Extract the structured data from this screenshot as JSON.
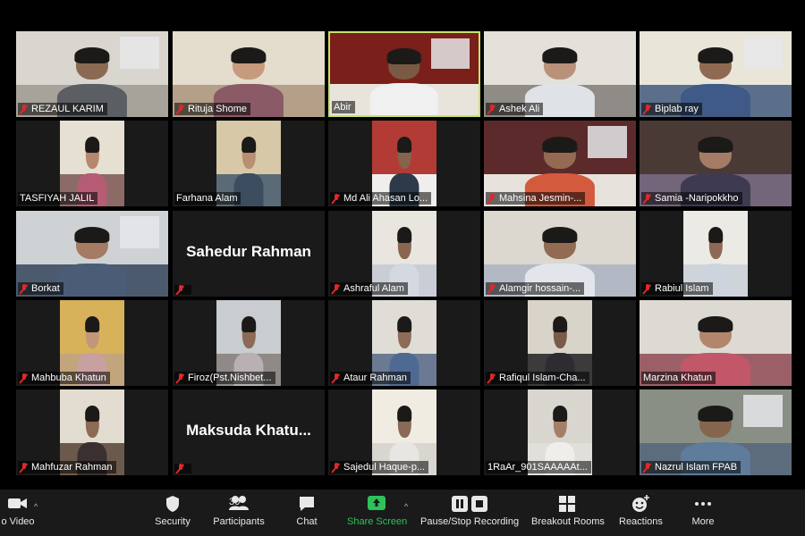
{
  "tiles": [
    {
      "name": "REZAUL KARIM",
      "muted": true,
      "wall": "#d9d6cf",
      "floor": "#a7a39a",
      "skin": "#8a6a52",
      "shirt": "#5b5e62"
    },
    {
      "name": "Rituja Shome",
      "muted": true,
      "wall": "#e4dccc",
      "floor": "#b49f88",
      "skin": "#c69a7c",
      "shirt": "#8a5a67"
    },
    {
      "name": "Abir",
      "muted": false,
      "active": true,
      "wall": "#7a1f1a",
      "floor": "#e8e4dc",
      "skin": "#7a5a45",
      "shirt": "#f0f0f0"
    },
    {
      "name": "Ashek Ali",
      "muted": true,
      "wall": "#e3e1da",
      "floor": "#8f8b86",
      "skin": "#b9917a",
      "shirt": "#dfe2e6"
    },
    {
      "name": "Biplab ray",
      "muted": true,
      "wall": "#e9e5d9",
      "floor": "#5b6f8b",
      "skin": "#8f6a52",
      "shirt": "#3f5a86"
    },
    {
      "name": "TASFIYAH JALIL",
      "muted": false,
      "wall": "#e6e0d2",
      "floor": "#8c6b67",
      "skin": "#b6876c",
      "shirt": "#b65c74"
    },
    {
      "name": "Farhana Alam",
      "muted": false,
      "wall": "#d7c8a8",
      "floor": "#5b6a77",
      "skin": "#b98e72",
      "shirt": "#3b4d5e"
    },
    {
      "name": "Md Ali Ahasan Lo...",
      "muted": true,
      "wall": "#b33b35",
      "floor": "#f0eeec",
      "skin": "#86634d",
      "shirt": "#2c3a4a"
    },
    {
      "name": "Mahsina Jesmin-...",
      "muted": true,
      "wall": "#5c2a2a",
      "floor": "#e7e2dc",
      "skin": "#946a52",
      "shirt": "#d35a3d"
    },
    {
      "name": "Samia -Naripokkho",
      "muted": true,
      "wall": "#4a3a35",
      "floor": "#73657a",
      "skin": "#a47c66",
      "shirt": "#3e3a52"
    },
    {
      "name": "Borkat",
      "muted": true,
      "wall": "#cfd2d5",
      "floor": "#4c5a6e",
      "skin": "#a57b63",
      "shirt": "#4b5c76"
    },
    {
      "name": "",
      "bigname": "Sahedur Rahman",
      "muted": true
    },
    {
      "name": "Ashraful Alam",
      "muted": true,
      "wall": "#e9e6df",
      "floor": "#c9ced6",
      "skin": "#8a6550",
      "shirt": "#d4d8e0"
    },
    {
      "name": "Alamgir hossain-...",
      "muted": true,
      "wall": "#dcd8cf",
      "floor": "#b3b9c4",
      "skin": "#916b54",
      "shirt": "#e2e6ec"
    },
    {
      "name": "Rabiul Islam",
      "muted": true,
      "wall": "#eceae4",
      "floor": "#cfd4da",
      "skin": "#8d6a56",
      "shirt": "#cdd4dd"
    },
    {
      "name": "Mahbuba Khatun",
      "muted": true,
      "wall": "#d7b25a",
      "floor": "#c3a57c",
      "skin": "#c29678",
      "shirt": "#c9a0a0"
    },
    {
      "name": "Firoz(Pst.Nishbet...",
      "muted": true,
      "wall": "#c9ccd0",
      "floor": "#8f8a87",
      "skin": "#8c6a55",
      "shirt": "#b8b0b2"
    },
    {
      "name": "Ataur Rahman",
      "muted": true,
      "wall": "#e0ddd6",
      "floor": "#6b7a92",
      "skin": "#8d6c58",
      "shirt": "#4e6a93"
    },
    {
      "name": "Rafiqul Islam-Cha...",
      "muted": true,
      "wall": "#d9d4c9",
      "floor": "#3d3a3c",
      "skin": "#7a5a48",
      "shirt": "#2e2c30"
    },
    {
      "name": "Marzina Khatun",
      "muted": false,
      "wall": "#dcdad2",
      "floor": "#9b6067",
      "skin": "#b3866b",
      "shirt": "#c2576a"
    },
    {
      "name": "Mahfuzar Rahman",
      "muted": true,
      "wall": "#e2ddd0",
      "floor": "#6b5a4c",
      "skin": "#8c6b55",
      "shirt": "#3a3030"
    },
    {
      "name": "",
      "bigname": "Maksuda  Khatu...",
      "muted": true
    },
    {
      "name": "Sajedul Haque-p...",
      "muted": true,
      "wall": "#f0ece2",
      "floor": "#d9d6d0",
      "skin": "#8a6a56",
      "shirt": "#e8e6e2"
    },
    {
      "name": "1RaAr_901SAAAAAt...",
      "muted": false,
      "wall": "#d9d6cf",
      "floor": "#e1dfda",
      "skin": "#a47f68",
      "shirt": "#f0eeea"
    },
    {
      "name": "Nazrul Islam FPAB",
      "muted": true,
      "wall": "#8a8f86",
      "floor": "#5c6c7d",
      "skin": "#86654f",
      "shirt": "#5f7d9a"
    }
  ],
  "toolbar": {
    "video_label": "o Video",
    "security_label": "Security",
    "participants_label": "Participants",
    "participants_count": "30",
    "chat_label": "Chat",
    "share_label": "Share Screen",
    "record_label": "Pause/Stop Recording",
    "breakout_label": "Breakout Rooms",
    "reactions_label": "Reactions",
    "more_label": "More",
    "share_color": "#2ec25a"
  }
}
